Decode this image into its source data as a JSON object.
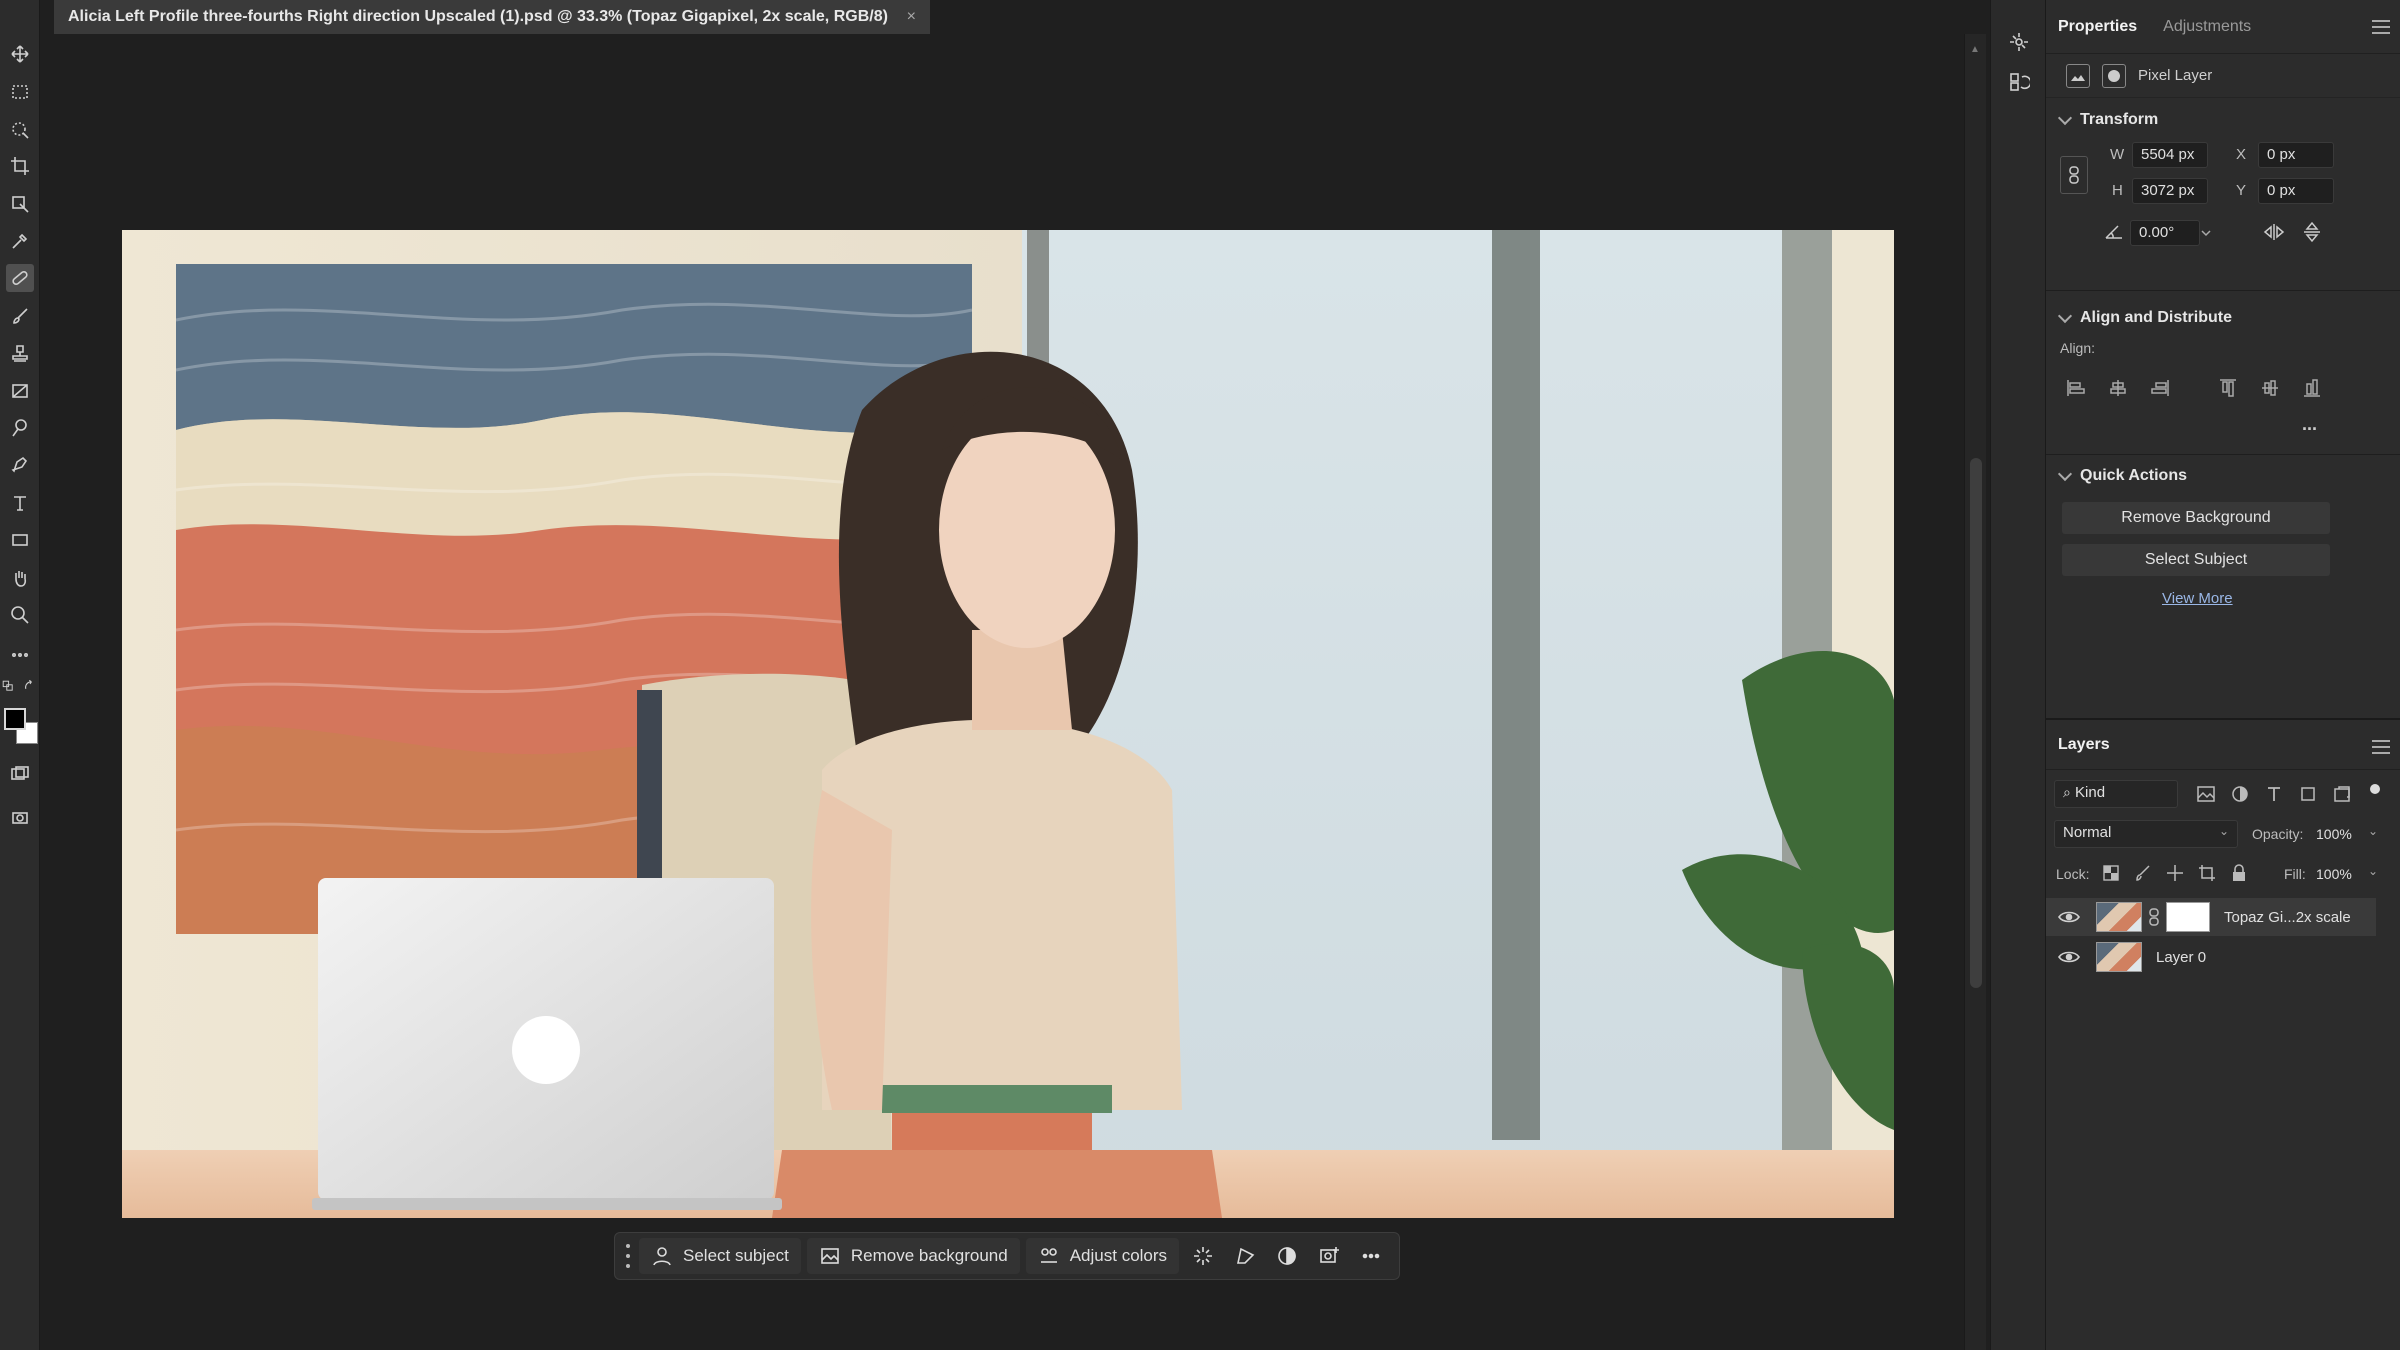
{
  "document": {
    "tab_title": "Alicia Left Profile three-fourths Right direction Upscaled (1).psd @ 33.3% (Topaz Gigapixel, 2x scale, RGB/8)",
    "close_glyph": "×"
  },
  "toolbar": {
    "tools": [
      "move-icon",
      "marquee-icon",
      "quick-selection-icon",
      "crop-icon",
      "frame-icon",
      "eyedropper-icon",
      "healing-brush-icon",
      "brush-icon",
      "clone-stamp-icon",
      "gradient-icon",
      "dodge-icon",
      "pen-icon",
      "type-icon",
      "rectangle-icon",
      "hand-icon",
      "zoom-icon",
      "more-tools-icon"
    ],
    "foreground_color": "#000000",
    "background_color": "#ffffff"
  },
  "taskbar": {
    "select_subject": "Select subject",
    "remove_background": "Remove background",
    "adjust_colors": "Adjust colors"
  },
  "properties_panel": {
    "tabs": [
      "Properties",
      "Adjustments"
    ],
    "layer_kind": "Pixel Layer",
    "transform": {
      "heading": "Transform",
      "w_label": "W",
      "w_value": "5504 px",
      "h_label": "H",
      "h_value": "3072 px",
      "x_label": "X",
      "x_value": "0 px",
      "y_label": "Y",
      "y_value": "0 px",
      "angle_value": "0.00°"
    },
    "align": {
      "heading": "Align and Distribute",
      "label": "Align:",
      "more": "..."
    },
    "quick_actions": {
      "heading": "Quick Actions",
      "remove_background": "Remove Background",
      "select_subject": "Select Subject",
      "view_more": "View More"
    }
  },
  "layers_panel": {
    "title": "Layers",
    "filter_kind": "Kind",
    "blend_mode": "Normal",
    "opacity_label": "Opacity:",
    "opacity_value": "100%",
    "lock_label": "Lock:",
    "fill_label": "Fill:",
    "fill_value": "100%",
    "layers": [
      {
        "name": "Topaz Gi...2x scale",
        "selected": true,
        "has_mask": true
      },
      {
        "name": "Layer 0",
        "selected": false,
        "has_mask": false
      }
    ]
  },
  "colors": {
    "app_bg": "#1f1f1f",
    "panel_bg": "#2c2c2c",
    "accent_link": "#9ab7e6"
  }
}
